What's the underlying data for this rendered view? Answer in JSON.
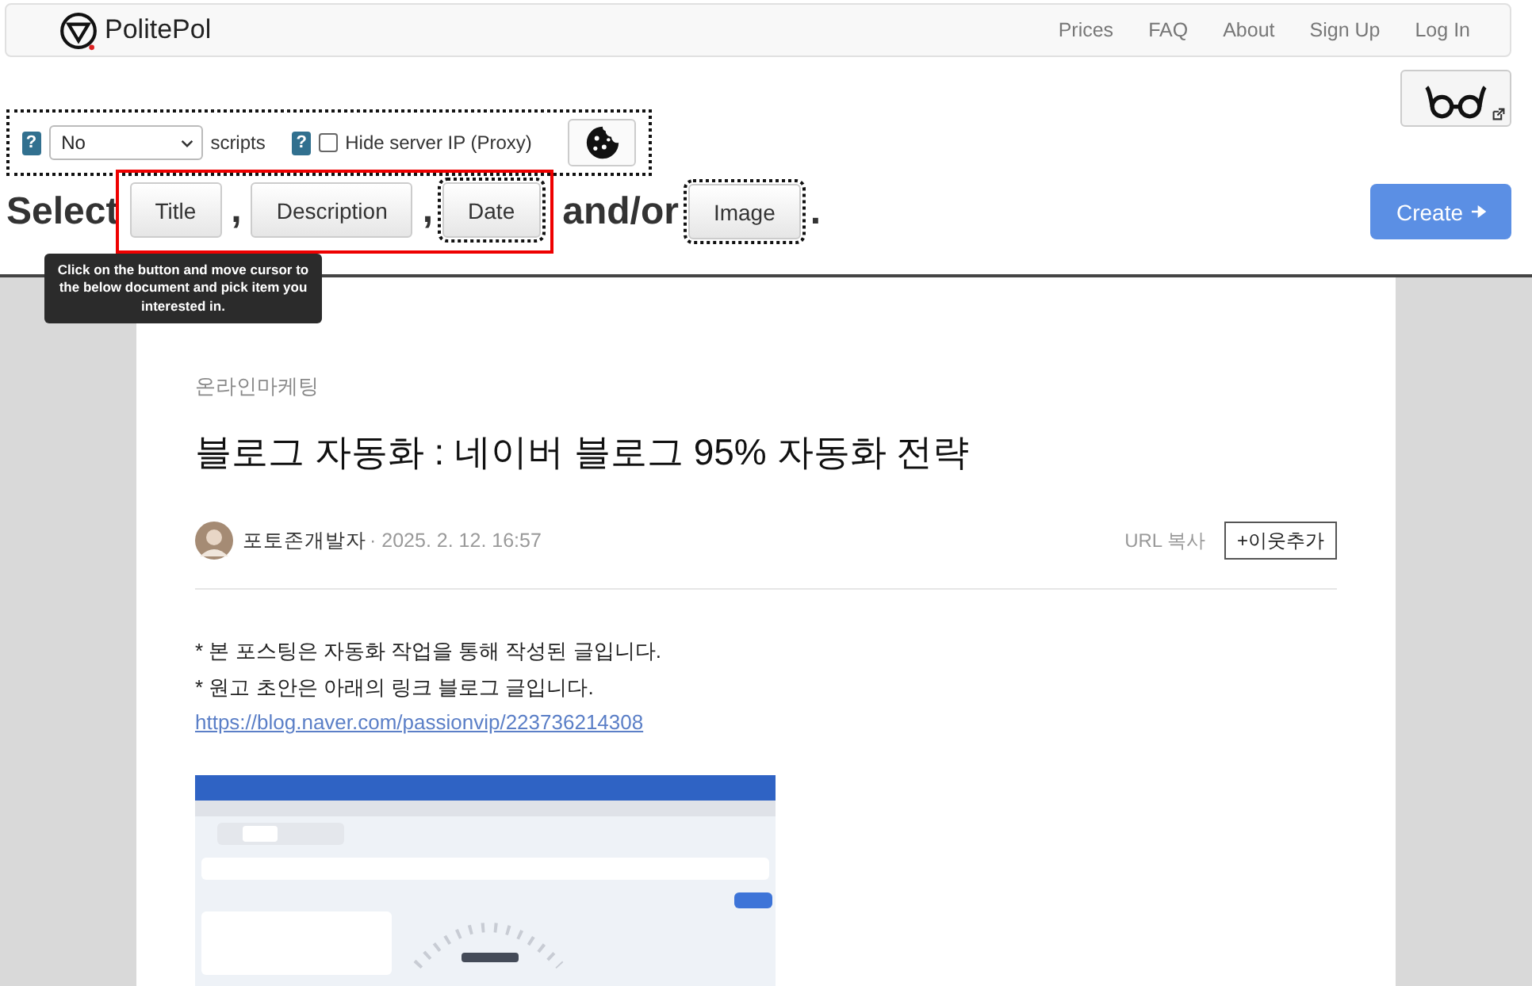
{
  "navbar": {
    "brand": "PolitePol",
    "links": [
      "Prices",
      "FAQ",
      "About",
      "Sign Up",
      "Log In"
    ]
  },
  "options": {
    "scripts_select": {
      "value": "No"
    },
    "scripts_label": "scripts",
    "help_marks": [
      "?",
      "?"
    ],
    "proxy": {
      "label": "Hide server IP (Proxy)",
      "checked": false
    }
  },
  "select_row": {
    "parts_before": [
      {
        "kind": "text",
        "text": "Select"
      }
    ],
    "highlighted_parts": [
      {
        "kind": "button",
        "text": "Title",
        "outlined": false
      },
      {
        "kind": "text",
        "text": ","
      },
      {
        "kind": "button",
        "text": "Description",
        "outlined": false
      },
      {
        "kind": "text",
        "text": ","
      },
      {
        "kind": "button",
        "text": "Date",
        "outlined": true
      }
    ],
    "parts_after": [
      {
        "kind": "text",
        "text": "and/or"
      },
      {
        "kind": "button",
        "text": "Image",
        "outlined": true
      },
      {
        "kind": "text",
        "text": "."
      }
    ],
    "tooltip": "Click on the button and move cursor to the below document and pick item you interested in.",
    "create_button": "Create"
  },
  "article": {
    "category": "온라인마케팅",
    "title": "블로그 자동화 : 네이버 블로그 95% 자동화 전략",
    "author": "포토존개발자",
    "date": "· 2025. 2. 12. 16:57",
    "url_copy": "URL 복사",
    "follow_button": "+이웃추가",
    "paragraphs": [
      {
        "kind": "text",
        "text": "* 본 포스팅은 자동화 작업을 통해 작성된 글입니다."
      },
      {
        "kind": "text",
        "text": "* 원고 초안은 아래의 링크 블로그 글입니다."
      },
      {
        "kind": "link",
        "text": "https://blog.naver.com/passionvip/223736214308"
      }
    ]
  }
}
